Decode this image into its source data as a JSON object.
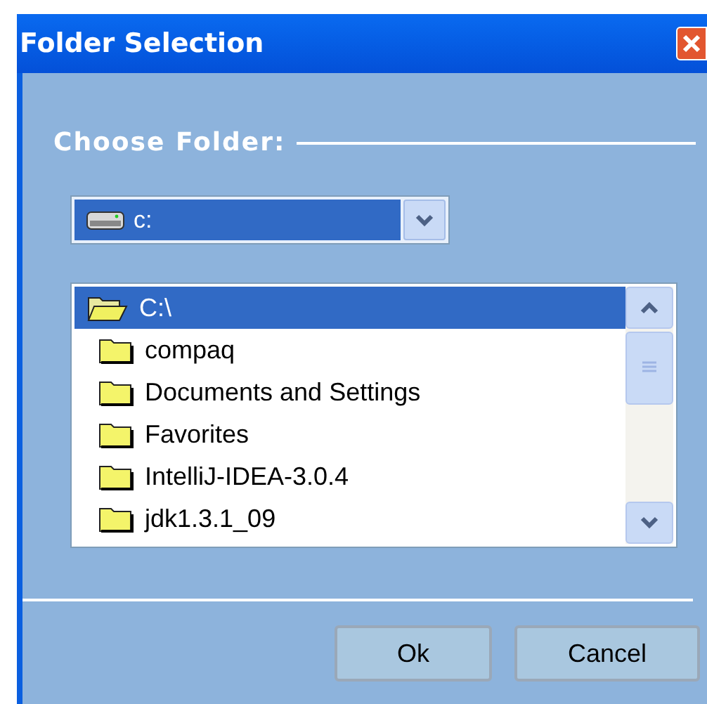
{
  "window": {
    "title": "Folder Selection"
  },
  "group": {
    "label": "Choose Folder:"
  },
  "drive_combo": {
    "value": "c:"
  },
  "folder_tree": [
    {
      "label": "C:\\",
      "selected": true,
      "open": true,
      "children": [
        {
          "label": "compaq",
          "selected": false,
          "open": false
        },
        {
          "label": "Documents and Settings",
          "selected": false,
          "open": false
        },
        {
          "label": "Favorites",
          "selected": false,
          "open": false
        },
        {
          "label": "IntelliJ-IDEA-3.0.4",
          "selected": false,
          "open": false
        },
        {
          "label": "jdk1.3.1_09",
          "selected": false,
          "open": false
        }
      ]
    }
  ],
  "buttons": [
    "Ok",
    "Cancel"
  ]
}
